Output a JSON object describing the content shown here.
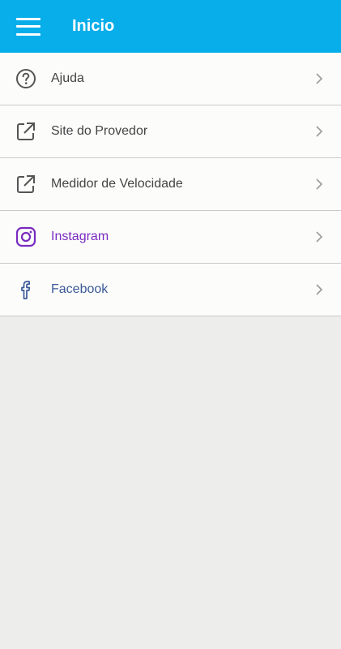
{
  "header": {
    "title": "Inicio",
    "menu_icon": "hamburger-menu-icon",
    "background": "#08aeea"
  },
  "menu": {
    "items": [
      {
        "label": "Ajuda",
        "icon": "help-circle-icon"
      },
      {
        "label": "Site do Provedor",
        "icon": "external-link-icon"
      },
      {
        "label": "Medidor de Velocidade",
        "icon": "external-link-icon"
      },
      {
        "label": "Instagram",
        "icon": "instagram-icon",
        "color": "#7a2bc0"
      },
      {
        "label": "Facebook",
        "icon": "facebook-icon",
        "color": "#3b5998"
      }
    ]
  }
}
